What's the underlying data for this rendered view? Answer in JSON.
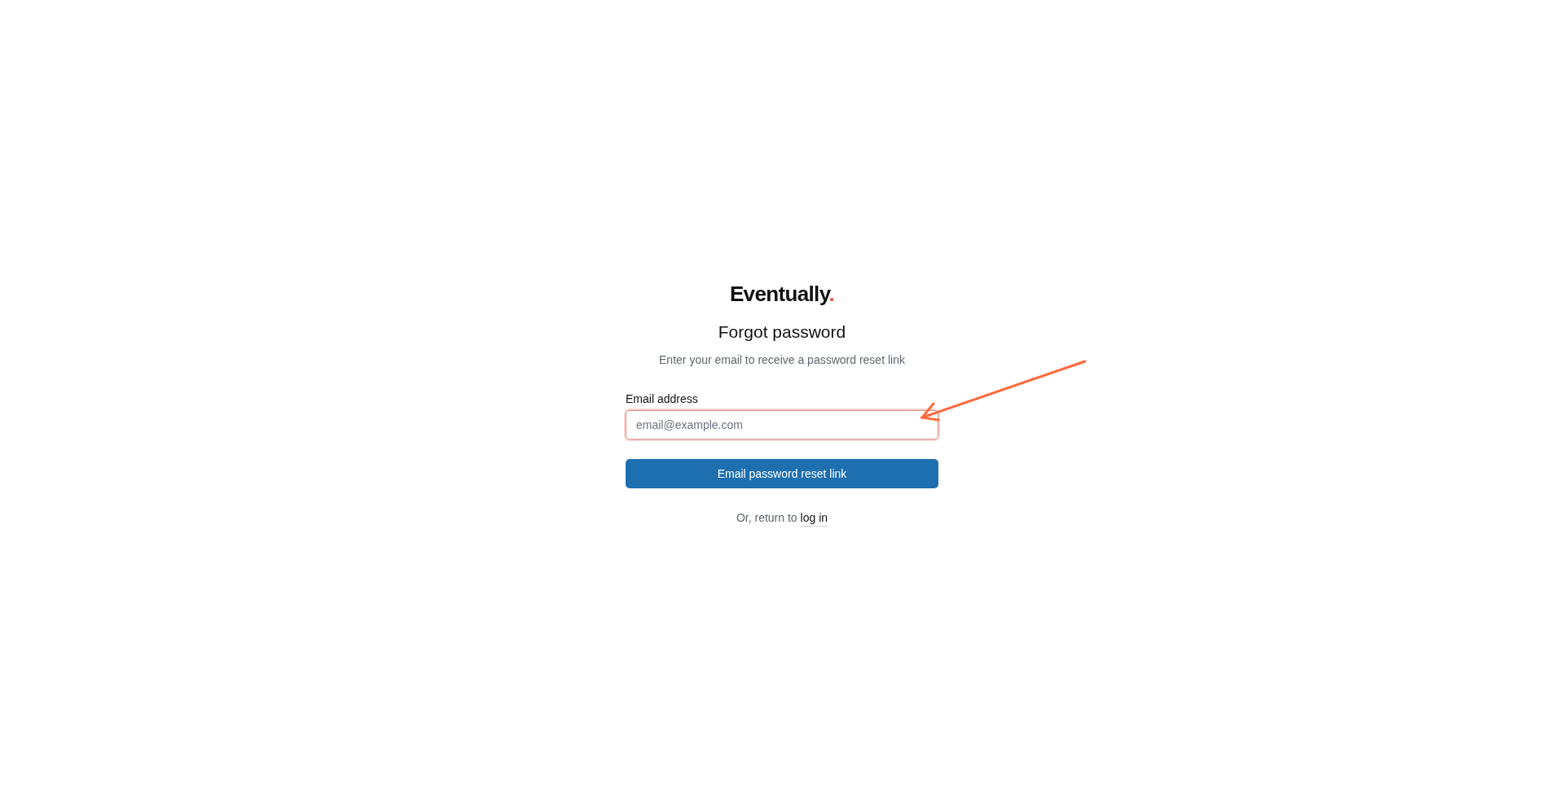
{
  "logo": {
    "text": "Eventually",
    "mark": "."
  },
  "heading": "Forgot password",
  "subtitle": "Enter your email to receive a password reset link",
  "email_field": {
    "label": "Email address",
    "placeholder": "email@example.com",
    "focused": true
  },
  "submit_button": "Email password reset link",
  "footer": {
    "text": "Or, return to",
    "link": "log in"
  },
  "annotation": {
    "kind": "arrow",
    "color": "#ff6a3d"
  }
}
